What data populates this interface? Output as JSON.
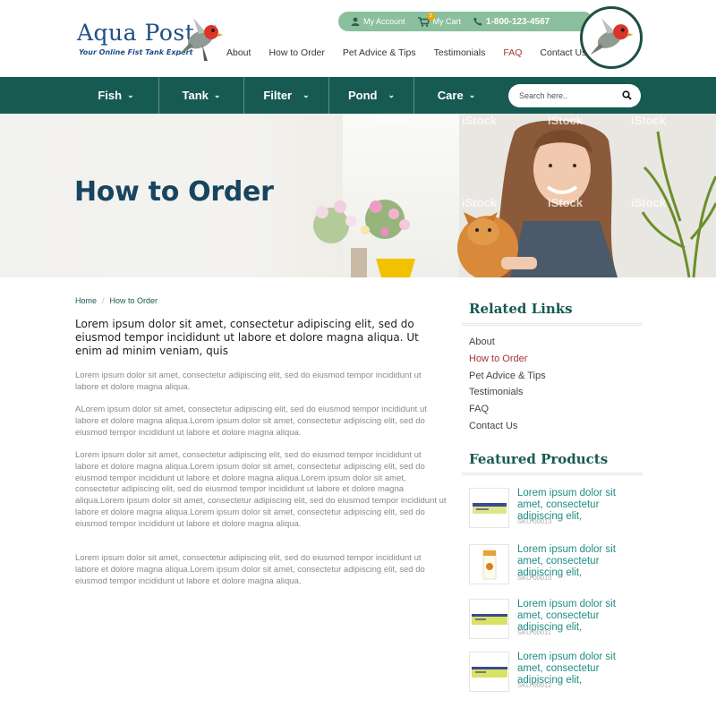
{
  "logo": {
    "title": "Aqua Post",
    "tagline": "Your Online Fist Tank Expert"
  },
  "topbar": {
    "account_label": "My Account",
    "cart_label": "My Cart",
    "cart_count": "3",
    "phone": "1-800-123-4567"
  },
  "main_nav": [
    "About",
    "How to Order",
    "Pet Advice & Tips",
    "Testimonials",
    "FAQ",
    "Contact Us"
  ],
  "categories": [
    "Fish",
    "Tank",
    "Filter",
    "Pond",
    "Care"
  ],
  "search": {
    "placeholder": "Search here.."
  },
  "hero": {
    "title": "How to Order",
    "watermark": "iStock"
  },
  "breadcrumb": {
    "home": "Home",
    "current": "How to Order"
  },
  "content": {
    "lead": "Lorem ipsum dolor sit amet, consectetur adipiscing elit, sed do eiusmod tempor incididunt ut labore et dolore magna aliqua. Ut enim ad minim veniam, quis",
    "paragraphs": [
      "Lorem ipsum dolor sit amet, consectetur adipiscing elit, sed do eiusmod tempor incididunt ut labore et dolore magna aliqua.",
      "ALorem ipsum dolor sit amet, consectetur adipiscing elit, sed do eiusmod tempor incididunt ut labore et dolore magna aliqua.Lorem ipsum dolor sit amet, consectetur adipiscing elit, sed do eiusmod tempor incididunt ut labore et dolore magna aliqua.",
      "Lorem ipsum dolor sit amet, consectetur adipiscing elit, sed do eiusmod tempor incididunt ut labore et dolore magna aliqua.Lorem ipsum dolor sit amet, consectetur adipiscing elit, sed do eiusmod tempor incididunt ut labore et dolore magna aliqua.Lorem ipsum dolor sit amet, consectetur adipiscing elit, sed do eiusmod tempor incididunt ut labore et dolore magna aliqua.Lorem ipsum dolor sit amet, consectetur adipiscing elit, sed do eiusmod tempor incididunt ut labore et dolore magna aliqua.Lorem ipsum dolor sit amet, consectetur adipiscing elit, sed do eiusmod tempor incididunt ut labore et dolore magna aliqua.",
      "Lorem ipsum dolor sit amet, consectetur adipiscing elit, sed do eiusmod tempor incididunt ut labore et dolore magna aliqua.Lorem ipsum dolor sit amet, consectetur adipiscing elit, sed do eiusmod tempor incididunt ut labore et dolore magna aliqua."
    ]
  },
  "sidebar": {
    "related_heading": "Related Links",
    "related_links": [
      "About",
      "How to Order",
      "Pet Advice & Tips",
      "Testimonials",
      "FAQ",
      "Contact Us"
    ],
    "featured_heading": "Featured Products",
    "products": [
      {
        "title": "Lorem ipsum dolor sit amet, consectetur adipiscing elit,",
        "sku": "SKU 00013"
      },
      {
        "title": "Lorem ipsum dolor sit amet, consectetur adipiscing elit,",
        "sku": "SKU 00010"
      },
      {
        "title": "Lorem ipsum dolor sit amet, consectetur adipiscing elit,",
        "sku": "SKU 00011"
      },
      {
        "title": "Lorem ipsum dolor sit amet, consectetur adipiscing elit,",
        "sku": "SKU 00012"
      }
    ]
  },
  "colors": {
    "brand_teal": "#175a52",
    "topbar_green": "#8bbf9d",
    "active_red": "#a33333",
    "link_teal": "#1e8c84",
    "logo_blue": "#1d4f86"
  }
}
